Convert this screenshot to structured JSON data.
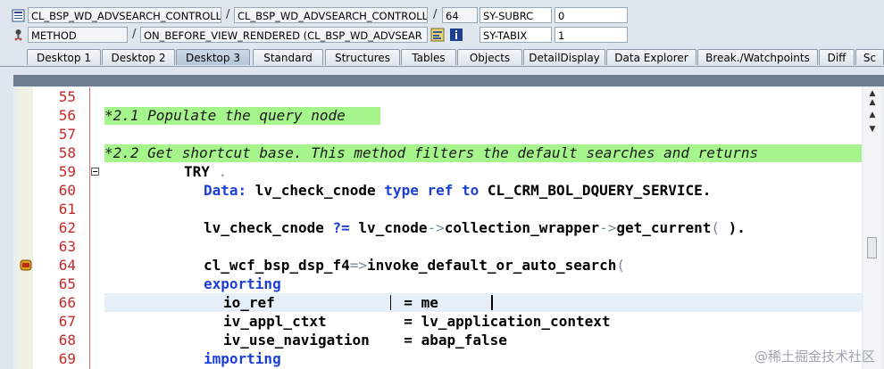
{
  "header": {
    "row1": {
      "icon": "program-list-icon",
      "field1": "CL_BSP_WD_ADVSEARCH_CONTROLLE",
      "field2": "CL_BSP_WD_ADVSEARCH_CONTROLLE",
      "field3": "64",
      "var_name": "SY-SUBRC",
      "var_value": "0"
    },
    "row2": {
      "icon": "method-pin-icon",
      "field1": "METHOD",
      "field2": "ON_BEFORE_VIEW_RENDERED (CL_BSP_WD_ADVSEAR",
      "btn1": "display-object-icon",
      "btn2": "info-icon",
      "var_name": "SY-TABIX",
      "var_value": "1"
    }
  },
  "tabs": [
    "Desktop 1",
    "Desktop 2",
    "Desktop 3",
    "Standard",
    "Structures",
    "Tables",
    "Objects",
    "DetailDisplay",
    "Data Explorer",
    "Break./Watchpoints",
    "Diff",
    "Sc"
  ],
  "active_tab": "Desktop 3",
  "editor": {
    "lines": [
      {
        "num": "55"
      },
      {
        "num": "56",
        "comment": "*2.1 Populate the query node"
      },
      {
        "num": "57"
      },
      {
        "num": "58",
        "comment": "*2.2 Get shortcut base. This method filters the default searches and returns"
      },
      {
        "num": "59",
        "t1": "TRY",
        "t2": " ."
      },
      {
        "num": "60",
        "t1": "Data:",
        "t2": " lv_check_cnode ",
        "t3": "type",
        "t4": " ",
        "t5": "ref",
        "t6": " ",
        "t7": "to",
        "t8": " CL_CRM_BOL_DQUERY_SERVICE."
      },
      {
        "num": "61"
      },
      {
        "num": "62",
        "t1": "lv_check_cnode ",
        "t2": "?=",
        "t3": " lv_cnode",
        "t4": "->",
        "t5": "collection_wrapper",
        "t6": "->",
        "t7": "get_current",
        "t8": "( ",
        "t9": ")."
      },
      {
        "num": "63"
      },
      {
        "num": "64",
        "t1": "cl_wcf_bsp_dsp_f4",
        "t2": "=>",
        "t3": "invoke_default_or_auto_search",
        "t4": "("
      },
      {
        "num": "65",
        "t1": "exporting"
      },
      {
        "num": "66",
        "t1": "io_ref",
        "t2": "               = ",
        "t3": "me"
      },
      {
        "num": "67",
        "t1": "iv_appl_ctxt",
        "t2": "         = ",
        "t3": "lv_application_context"
      },
      {
        "num": "68",
        "t1": "iv_use_navigation",
        "t2": "    = ",
        "t3": "abap_false"
      },
      {
        "num": "69",
        "t1": "importing"
      }
    ]
  },
  "watermark": "@稀土掘金技术社区",
  "colors": {
    "comment_bg": "#a6f58c",
    "keyword": "#1b3fd8",
    "line_number": "#c62828",
    "active_tab": "#b5c6d8"
  }
}
